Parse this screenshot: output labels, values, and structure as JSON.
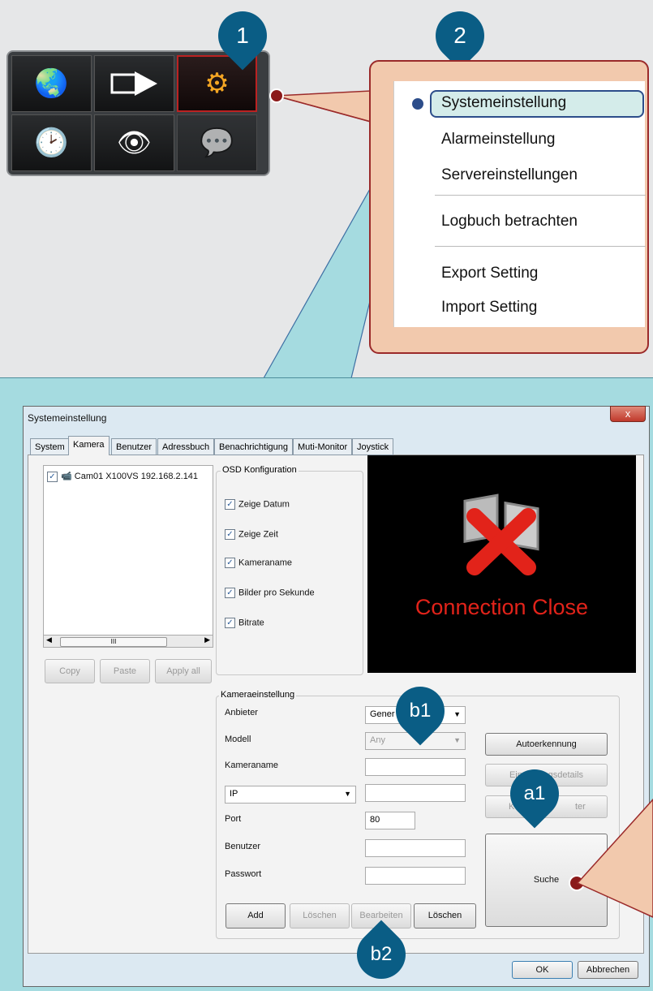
{
  "colors": {
    "pin": "#0a5d85",
    "callout": "#f2c9ad",
    "callout_border": "#9b2a2a",
    "frame": "#a5dbe0",
    "dot": "#8b1a1a"
  },
  "pins": {
    "p1": "1",
    "p2": "2",
    "b1": "b1",
    "b2": "b2",
    "a1": "a1"
  },
  "toolbar": {
    "icons": [
      "world-map-icon",
      "video-play-icon",
      "settings-gears-icon",
      "clock-log-icon",
      "eye-icon",
      "chat-bubble-icon"
    ]
  },
  "menu": {
    "items": [
      "Systemeinstellung",
      "Alarmeinstellung",
      "Servereinstellungen",
      "Logbuch betrachten",
      "Export Setting",
      "Import Setting"
    ]
  },
  "dialog": {
    "title": "Systemeinstellung",
    "close": "x",
    "tabs": [
      "System",
      "Kamera",
      "Benutzer",
      "Adressbuch",
      "Benachrichtigung",
      "Muti-Monitor",
      "Joystick"
    ],
    "tree_item": "Cam01 X100VS 192.168.2.141",
    "scroll_mark": "III",
    "left_buttons": [
      "Copy",
      "Paste",
      "Apply all"
    ],
    "osd": {
      "title": "OSD Konfiguration",
      "options": [
        "Zeige Datum",
        "Zeige Zeit",
        "Kameraname",
        "Bilder pro Sekunde",
        "Bitrate"
      ]
    },
    "preview_text": "Connection Close",
    "cam": {
      "title": "Kameraeinstellung",
      "anbieter_label": "Anbieter",
      "anbieter_value": "Gener",
      "modell_label": "Modell",
      "modell_value": "Any",
      "kameraname_label": "Kameraname",
      "ip_value": "IP",
      "port_label": "Port",
      "port_value": "80",
      "benutzer_label": "Benutzer",
      "passwort_label": "Passwort",
      "btn_autoerkennung": "Autoerkennung",
      "btn_einstellungsdetails": "Einstellungsdetails",
      "btn_kamera_left": "K",
      "btn_kamera_right": "ter",
      "btn_suche": "Suche",
      "btn_add": "Add",
      "btn_loeschen1": "Löschen",
      "btn_bearbeiten": "Bearbeiten",
      "btn_loeschen2": "Löschen"
    },
    "ok": "OK",
    "abbrechen": "Abbrechen"
  }
}
